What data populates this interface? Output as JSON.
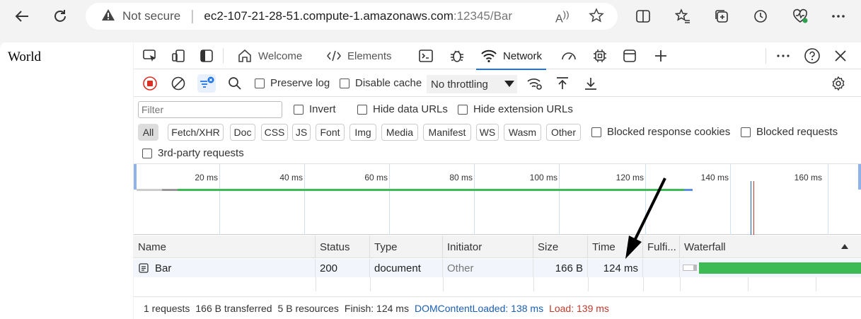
{
  "browser": {
    "security_label": "Not secure",
    "url_host": "ec2-107-21-28-51.compute-1.amazonaws.com",
    "url_path": ":12345/Bar"
  },
  "page": {
    "text": "World"
  },
  "devtools": {
    "tabs": [
      {
        "label": "Welcome",
        "icon": "home-icon"
      },
      {
        "label": "Elements",
        "icon": "code-icon"
      },
      {
        "label": "Network",
        "icon": "wifi-icon",
        "active": true
      }
    ],
    "toolbar": {
      "preserve_log": "Preserve log",
      "disable_cache": "Disable cache",
      "throttling": "No throttling"
    },
    "filter": {
      "placeholder": "Filter",
      "invert": "Invert",
      "hide_data_urls": "Hide data URLs",
      "hide_ext_urls": "Hide extension URLs",
      "chips": [
        "All",
        "Fetch/XHR",
        "Doc",
        "CSS",
        "JS",
        "Font",
        "Img",
        "Media",
        "Manifest",
        "WS",
        "Wasm",
        "Other"
      ],
      "blocked_cookies": "Blocked response cookies",
      "blocked_requests": "Blocked requests",
      "third_party": "3rd-party requests"
    },
    "overview_ticks": [
      "20 ms",
      "40 ms",
      "60 ms",
      "80 ms",
      "100 ms",
      "120 ms",
      "140 ms",
      "160 ms"
    ],
    "table": {
      "headers": [
        "Name",
        "Status",
        "Type",
        "Initiator",
        "Size",
        "Time",
        "Fulfi...",
        "Waterfall"
      ],
      "rows": [
        {
          "name": "Bar",
          "status": "200",
          "type": "document",
          "initiator": "Other",
          "size": "166 B",
          "time": "124 ms"
        }
      ]
    },
    "status": {
      "requests": "1 requests",
      "transferred": "166 B transferred",
      "resources": "5 B resources",
      "finish": "Finish: 124 ms",
      "dcl": "DOMContentLoaded: 138 ms",
      "load": "Load: 139 ms"
    }
  },
  "colors": {
    "accent": "#1a73e8",
    "waterfall_bar": "#3cba54",
    "dcl": "#1a5fb4",
    "load": "#c0392b"
  }
}
